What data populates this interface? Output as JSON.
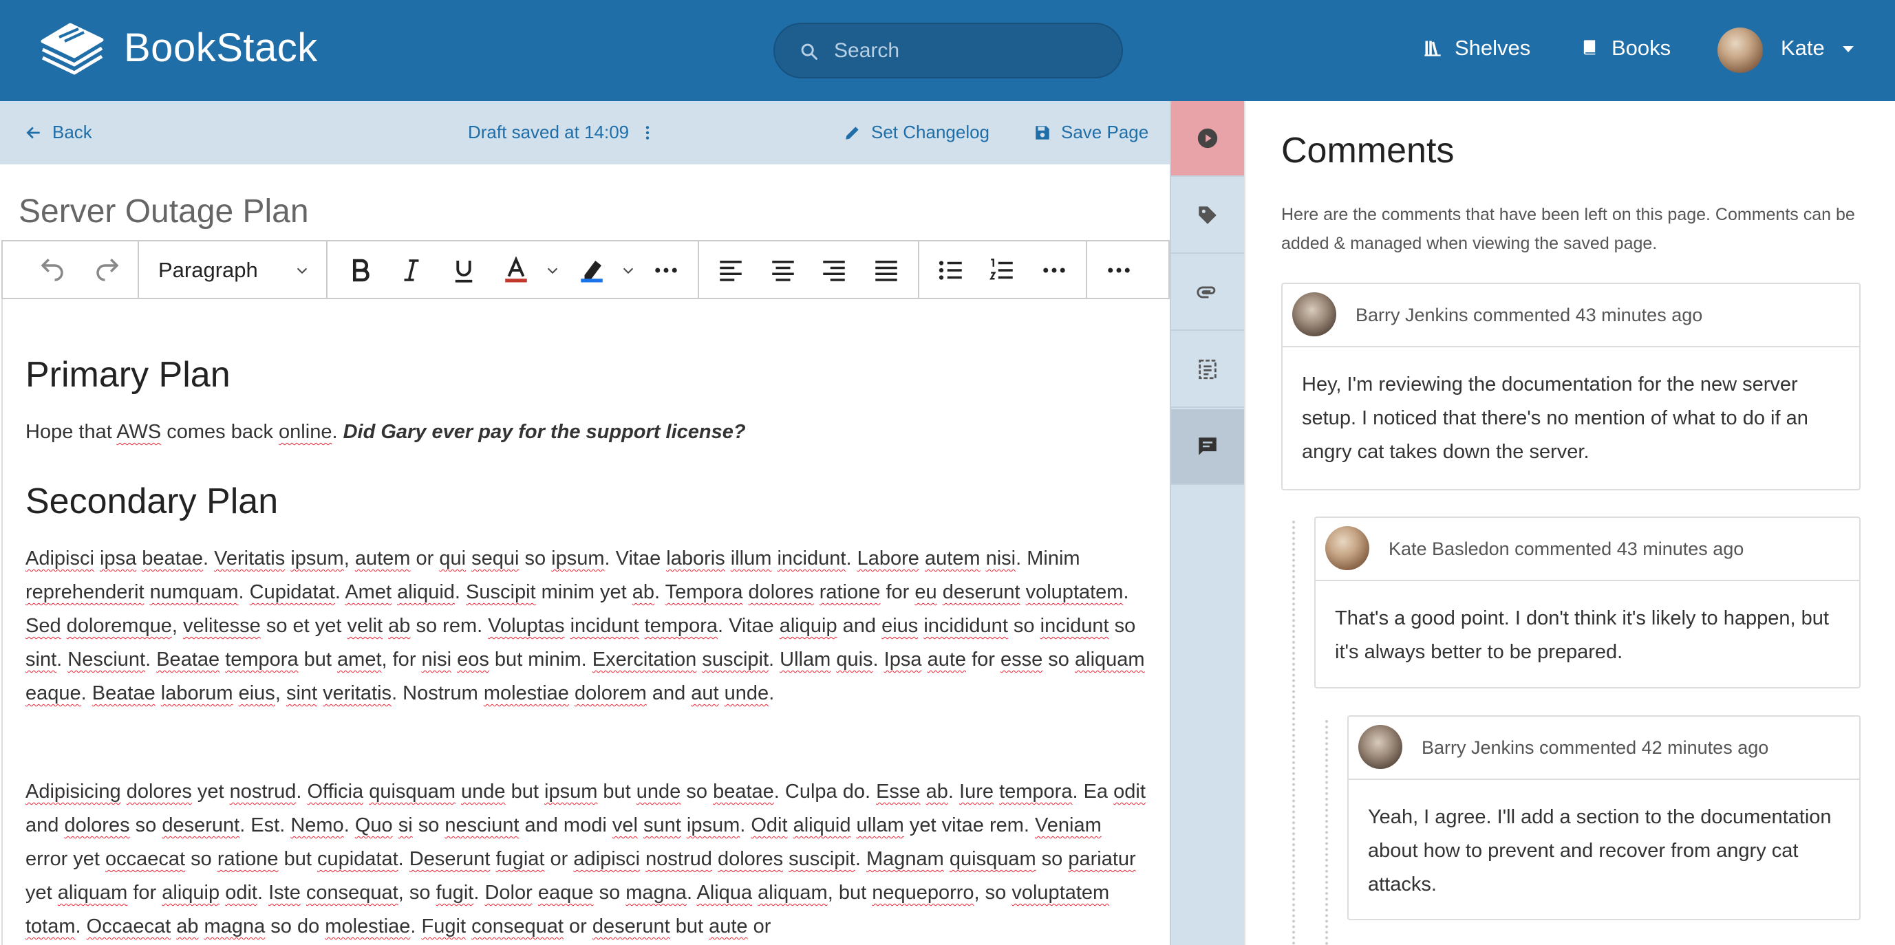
{
  "header": {
    "app_name": "BookStack",
    "search_placeholder": "Search",
    "nav": {
      "shelves": "Shelves",
      "books": "Books"
    },
    "user_name": "Kate",
    "color": "#206ea7"
  },
  "edit_bar": {
    "back": "Back",
    "draft_status": "Draft saved at 14:09",
    "set_changelog": "Set Changelog",
    "save_page": "Save Page"
  },
  "page": {
    "title": "Server Outage Plan"
  },
  "toolbar": {
    "block_format": "Paragraph"
  },
  "content": {
    "h1": "Primary Plan",
    "p1_pre": "Hope that ",
    "p1_w1": "AWS",
    "p1_mid": " comes back ",
    "p1_w2": "online",
    "p1_post": ". ",
    "p1_bold": "Did Gary ever pay for the support license?",
    "h2": "Secondary Plan"
  },
  "comments": {
    "title": "Comments",
    "description": "Here are the comments that have been left on this page. Comments can be added & managed when viewing the saved page.",
    "items": [
      {
        "meta": "Barry Jenkins commented 43 minutes ago",
        "body": "Hey, I'm reviewing the documentation for the new server setup. I noticed that there's no mention of what to do if an angry cat takes down the server."
      },
      {
        "meta": "Kate Basledon commented 43 minutes ago",
        "body": "That's a good point. I don't think it's likely to happen, but it's always better to be prepared."
      },
      {
        "meta": "Barry Jenkins commented 42 minutes ago",
        "body": "Yeah, I agree. I'll add a section to the documentation about how to prevent and recover from angry cat attacks."
      }
    ]
  },
  "icons": {
    "logo": "bookstack-logo-icon",
    "search": "search-icon",
    "shelves": "shelves-icon",
    "books": "book-icon",
    "back": "arrow-left-icon",
    "draft_menu": "more-vertical-icon",
    "changelog": "pencil-icon",
    "save": "save-icon",
    "tabs": [
      "play-circle-icon",
      "tag-icon",
      "paperclip-icon",
      "template-icon",
      "comment-icon"
    ]
  }
}
